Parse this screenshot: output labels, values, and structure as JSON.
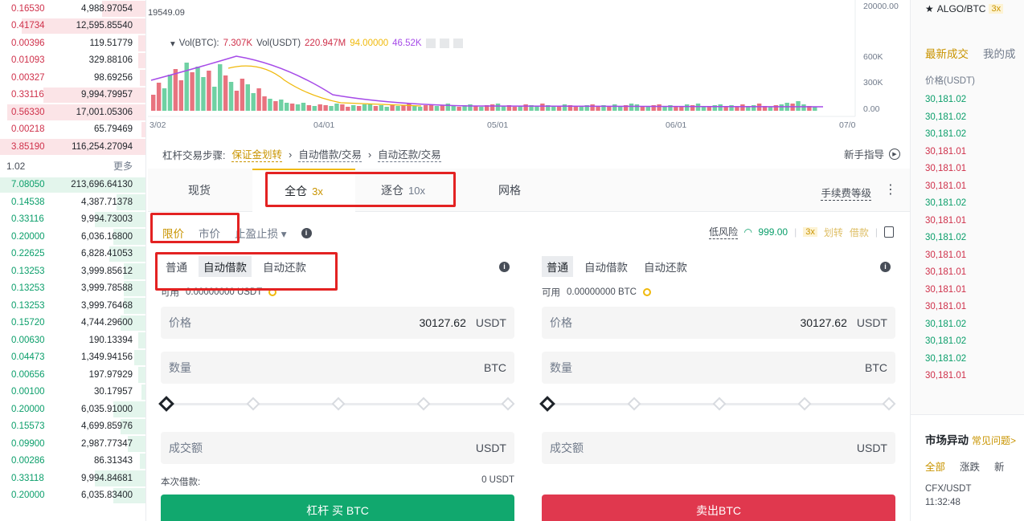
{
  "orderbook": {
    "asks": [
      {
        "price": "0.16530",
        "amount": "4,988.97054",
        "depth": 0.3
      },
      {
        "price": "0.41734",
        "amount": "12,595.85540",
        "depth": 0.85
      },
      {
        "price": "0.00396",
        "amount": "119.51779",
        "depth": 0.05
      },
      {
        "price": "0.01093",
        "amount": "329.88106",
        "depth": 0.05
      },
      {
        "price": "0.00327",
        "amount": "98.69256",
        "depth": 0.04
      },
      {
        "price": "0.33116",
        "amount": "9,994.79957",
        "depth": 0.7
      },
      {
        "price": "0.56330",
        "amount": "17,001.05306",
        "depth": 0.95
      },
      {
        "price": "0.00218",
        "amount": "65.79469",
        "depth": 0.03
      },
      {
        "price": "3.85190",
        "amount": "116,254.27094",
        "depth": 1.0
      }
    ],
    "mid_price": "1.02",
    "more_label": "更多",
    "bids": [
      {
        "price": "7.08050",
        "amount": "213,696.64130",
        "depth": 1.0
      },
      {
        "price": "0.14538",
        "amount": "4,387.71378",
        "depth": 0.2
      },
      {
        "price": "0.33116",
        "amount": "9,994.73003",
        "depth": 0.35
      },
      {
        "price": "0.20000",
        "amount": "6,036.16800",
        "depth": 0.22
      },
      {
        "price": "0.22625",
        "amount": "6,828.41053",
        "depth": 0.25
      },
      {
        "price": "0.13253",
        "amount": "3,999.85612",
        "depth": 0.15
      },
      {
        "price": "0.13253",
        "amount": "3,999.78588",
        "depth": 0.15
      },
      {
        "price": "0.13253",
        "amount": "3,999.76468",
        "depth": 0.15
      },
      {
        "price": "0.15720",
        "amount": "4,744.29600",
        "depth": 0.17
      },
      {
        "price": "0.00630",
        "amount": "190.13394",
        "depth": 0.05
      },
      {
        "price": "0.04473",
        "amount": "1,349.94156",
        "depth": 0.08
      },
      {
        "price": "0.00656",
        "amount": "197.97929",
        "depth": 0.05
      },
      {
        "price": "0.00100",
        "amount": "30.17957",
        "depth": 0.03
      },
      {
        "price": "0.20000",
        "amount": "6,035.91000",
        "depth": 0.22
      },
      {
        "price": "0.15573",
        "amount": "4,699.85976",
        "depth": 0.17
      },
      {
        "price": "0.09900",
        "amount": "2,987.77347",
        "depth": 0.12
      },
      {
        "price": "0.00286",
        "amount": "86.31343",
        "depth": 0.04
      },
      {
        "price": "0.33118",
        "amount": "9,994.84681",
        "depth": 0.35
      },
      {
        "price": "0.20000",
        "amount": "6,035.83400",
        "depth": 0.22
      }
    ]
  },
  "chart": {
    "price_tag": "19549.09",
    "legend": {
      "vol_btc_label": "Vol(BTC):",
      "vol_btc": "7.307K",
      "vol_usdt_label": "Vol(USDT)",
      "vol_usdt": "220.947M",
      "ma1": "94.00000",
      "ma2": "46.52K"
    },
    "y_ticks": [
      "20000.00",
      "600K",
      "300K",
      "0.00"
    ],
    "x_ticks": [
      "3/02",
      "04/01",
      "05/01",
      "06/01",
      "07/0"
    ]
  },
  "main": {
    "steps": {
      "prefix": "杠杆交易步骤:",
      "step1": "保证金划转",
      "step2": "自动借款/交易",
      "step3": "自动还款/交易"
    },
    "guide_label": "新手指导",
    "tabs": {
      "spot": "现货",
      "cross": "全仓",
      "cross_lev": "3x",
      "isolated": "逐仓",
      "isolated_lev": "10x",
      "grid": "网格"
    },
    "fee_level": "手续费等级",
    "order_types": {
      "limit": "限价",
      "market": "市价",
      "stop": "止盈止损"
    },
    "risk": {
      "label": "低风险",
      "ratio": "999.00",
      "lev": "3x",
      "transfer": "划转",
      "borrow": "借款"
    },
    "buy": {
      "mode_normal": "普通",
      "mode_auto_borrow": "自动借款",
      "mode_auto_repay": "自动还款",
      "avail_label": "可用",
      "avail_value": "0.00000000 USDT",
      "price_label": "价格",
      "price_value": "30127.62",
      "price_unit": "USDT",
      "amount_label": "数量",
      "amount_unit": "BTC",
      "total_label": "成交额",
      "total_unit": "USDT",
      "borrow_label": "本次借款:",
      "borrow_value": "0 USDT",
      "button": "杠杆 买 BTC"
    },
    "sell": {
      "mode_normal": "普通",
      "mode_auto_borrow": "自动借款",
      "mode_auto_repay": "自动还款",
      "avail_label": "可用",
      "avail_value": "0.00000000 BTC",
      "price_label": "价格",
      "price_value": "30127.62",
      "price_unit": "USDT",
      "amount_label": "数量",
      "amount_unit": "BTC",
      "total_label": "成交额",
      "total_unit": "USDT",
      "button": "卖出BTC"
    }
  },
  "trades": {
    "pair": "ALGO/BTC",
    "pair_lev": "3x",
    "tab_latest": "最新成交",
    "tab_mine": "我的成",
    "header_price": "价格(USDT)",
    "rows": [
      {
        "price": "30,181.02",
        "side": "up"
      },
      {
        "price": "30,181.02",
        "side": "up"
      },
      {
        "price": "30,181.02",
        "side": "up"
      },
      {
        "price": "30,181.01",
        "side": "down"
      },
      {
        "price": "30,181.01",
        "side": "down"
      },
      {
        "price": "30,181.01",
        "side": "down"
      },
      {
        "price": "30,181.02",
        "side": "up"
      },
      {
        "price": "30,181.01",
        "side": "down"
      },
      {
        "price": "30,181.02",
        "side": "up"
      },
      {
        "price": "30,181.01",
        "side": "down"
      },
      {
        "price": "30,181.01",
        "side": "down"
      },
      {
        "price": "30,181.01",
        "side": "down"
      },
      {
        "price": "30,181.01",
        "side": "down"
      },
      {
        "price": "30,181.02",
        "side": "up"
      },
      {
        "price": "30,181.02",
        "side": "up"
      },
      {
        "price": "30,181.02",
        "side": "up"
      },
      {
        "price": "30,181.01",
        "side": "down"
      }
    ],
    "market_moves_title": "市场异动",
    "faq": "常见问题>",
    "mkt_tab_all": "全部",
    "mkt_tab_change": "涨跌",
    "mkt_tab_new": "新",
    "mkt_symbol": "CFX/USDT",
    "mkt_time": "11:32:48"
  },
  "colors": {
    "ask": "#cf304a",
    "bid": "#0a9e6a",
    "accent": "#c99400",
    "buy_button": "#11a86e",
    "sell_button": "#e0384e",
    "annotation": "#e32222"
  }
}
